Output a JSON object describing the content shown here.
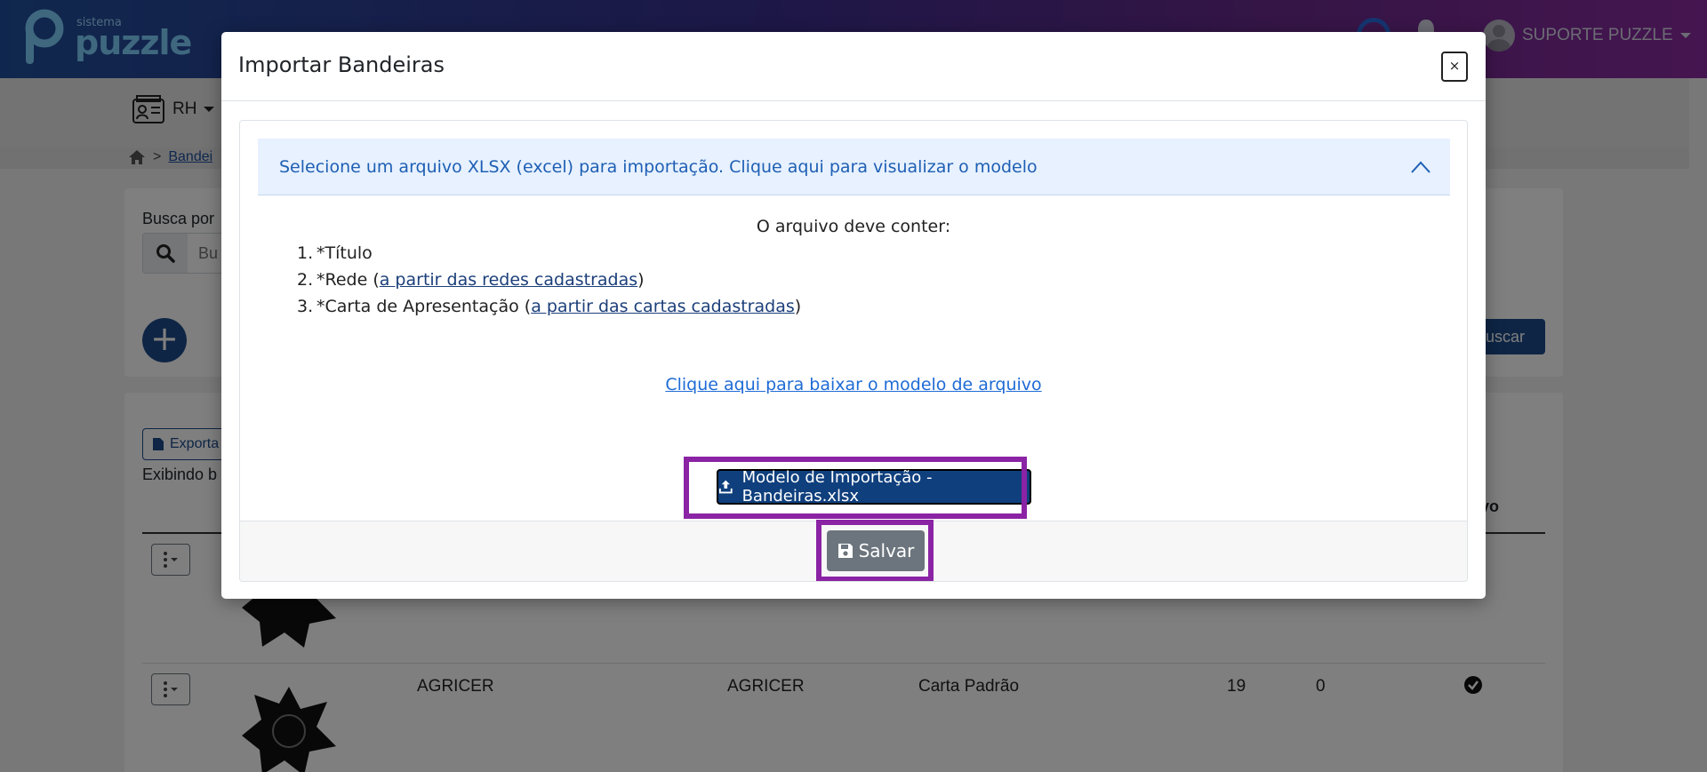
{
  "app": {
    "logo_small": "sistema",
    "logo_big": "puzzle",
    "user_name": "SUPORTE PUZZLE",
    "module": "RH"
  },
  "breadcrumb": {
    "separator": ">",
    "current": "Bandei"
  },
  "search": {
    "label": "Busca por",
    "placeholder": "Bu",
    "button_label": "Buscar",
    "add_label": "+"
  },
  "table": {
    "export_label": "Exporta",
    "showing_text": "Exibindo b",
    "header_active": "ivo",
    "row": {
      "name": "AGRICER",
      "network": "AGRICER",
      "letter": "Carta Padrão",
      "count_a": "19",
      "count_b": "0"
    }
  },
  "modal": {
    "title": "Importar Bandeiras",
    "close_label": "×",
    "accordion_text": "Selecione um arquivo XLSX (excel) para importação. Clique aqui para visualizar o modelo",
    "must_contain": "O arquivo deve conter:",
    "requirements": [
      {
        "num": "1.",
        "prefix": "*Título",
        "link": "",
        "suffix": ""
      },
      {
        "num": "2.",
        "prefix": "*Rede (",
        "link": "a partir das redes cadastradas",
        "suffix": ")"
      },
      {
        "num": "3.",
        "prefix": "*Carta de Apresentação (",
        "link": "a partir das cartas cadastradas",
        "suffix": ")"
      }
    ],
    "download_link": "Clique aqui para baixar o modelo de arquivo",
    "model_button": "Modelo de Importação - Bandeiras.xlsx",
    "save_button": "Salvar"
  },
  "colors": {
    "highlight": "#8b23a5",
    "primary": "#0f3f7d",
    "accordion_bg": "#e7f1ff",
    "accordion_text": "#1e5fb3",
    "save_bg": "#6c757d"
  }
}
